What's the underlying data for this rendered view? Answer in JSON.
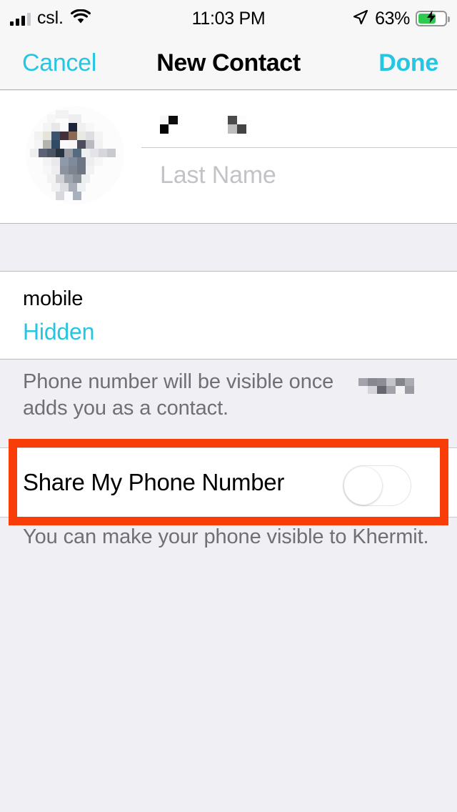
{
  "status_bar": {
    "carrier": "csl.",
    "time": "11:03 PM",
    "battery_percent": "63%",
    "signal_bars_filled": 3,
    "signal_bars_total": 4,
    "battery_level": 63,
    "battery_charging": true,
    "icons": {
      "signal": "signal-bars-icon",
      "wifi": "wifi-icon",
      "location": "location-arrow-icon",
      "battery": "battery-charging-icon"
    },
    "colors": {
      "battery_fill": "#2ecb4f",
      "bar_filled": "#000000",
      "bar_empty": "#c8c8cd"
    }
  },
  "nav_bar": {
    "cancel_label": "Cancel",
    "title": "New Contact",
    "done_label": "Done",
    "tint_color": "#25c6e1"
  },
  "name_section": {
    "avatar": "contact-photo-pixelated",
    "first_name_value": "",
    "first_name_redacted": true,
    "last_name_placeholder": "Last Name",
    "last_name_value": ""
  },
  "phone_section": {
    "label": "mobile",
    "value": "Hidden",
    "value_color": "#25c6e1"
  },
  "note_1": {
    "line1": "Phone number will be visible once",
    "line2": "adds you as a contact.",
    "redacted_name": true
  },
  "toggle_row": {
    "label": "Share My Phone Number",
    "state": "off"
  },
  "note_2": {
    "text": "You can make your phone visible to Khermit."
  },
  "annotation": {
    "color": "#f93d08",
    "target": "share-my-phone-number-row"
  }
}
